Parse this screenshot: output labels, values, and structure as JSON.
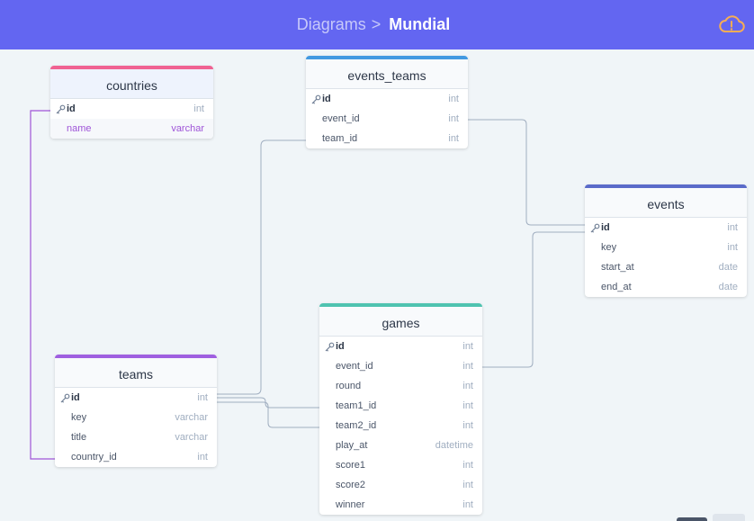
{
  "breadcrumb": {
    "parent": "Diagrams",
    "separator": ">",
    "current": "Mundial"
  },
  "colors": {
    "header": "#6366f1",
    "countries": "#f06292",
    "events_teams": "#4299e1",
    "events": "#5a6bc9",
    "games": "#4fc3b0",
    "teams": "#9f5fe0",
    "link_gray": "#a0aec0",
    "link_purple": "#9f55d8",
    "cloud_warning": "#f6ad55"
  },
  "tables": {
    "countries": {
      "name": "countries",
      "columns": [
        {
          "name": "id",
          "type": "int"
        },
        {
          "name": "name",
          "type": "varchar"
        }
      ]
    },
    "events_teams": {
      "name": "events_teams",
      "columns": [
        {
          "name": "id",
          "type": "int"
        },
        {
          "name": "event_id",
          "type": "int"
        },
        {
          "name": "team_id",
          "type": "int"
        }
      ]
    },
    "events": {
      "name": "events",
      "columns": [
        {
          "name": "id",
          "type": "int"
        },
        {
          "name": "key",
          "type": "int"
        },
        {
          "name": "start_at",
          "type": "date"
        },
        {
          "name": "end_at",
          "type": "date"
        }
      ]
    },
    "games": {
      "name": "games",
      "columns": [
        {
          "name": "id",
          "type": "int"
        },
        {
          "name": "event_id",
          "type": "int"
        },
        {
          "name": "round",
          "type": "int"
        },
        {
          "name": "team1_id",
          "type": "int"
        },
        {
          "name": "team2_id",
          "type": "int"
        },
        {
          "name": "play_at",
          "type": "datetime"
        },
        {
          "name": "score1",
          "type": "int"
        },
        {
          "name": "score2",
          "type": "int"
        },
        {
          "name": "winner",
          "type": "int"
        }
      ]
    },
    "teams": {
      "name": "teams",
      "columns": [
        {
          "name": "id",
          "type": "int"
        },
        {
          "name": "key",
          "type": "varchar"
        },
        {
          "name": "title",
          "type": "varchar"
        },
        {
          "name": "country_id",
          "type": "int"
        }
      ]
    }
  },
  "relations": [
    {
      "from": "teams.country_id",
      "to": "countries.id"
    },
    {
      "from": "events_teams.team_id",
      "to": "teams.id"
    },
    {
      "from": "events_teams.event_id",
      "to": "events.id"
    },
    {
      "from": "games.event_id",
      "to": "events.id"
    },
    {
      "from": "games.team1_id",
      "to": "teams.id"
    },
    {
      "from": "games.team2_id",
      "to": "teams.id"
    }
  ]
}
